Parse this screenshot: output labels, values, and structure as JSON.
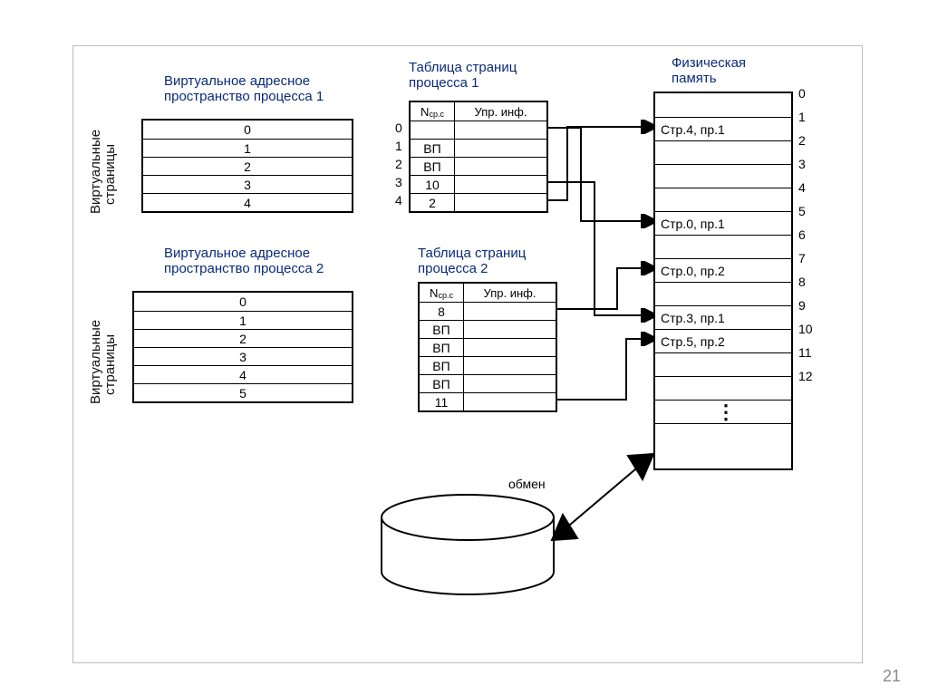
{
  "titles": {
    "vas1_l1": "Виртуальное адресное",
    "vas1_l2": "пространство процесса 1",
    "vas2_l1": "Виртуальное адресное",
    "vas2_l2": "пространство процесса 2",
    "pt1_l1": "Таблица страниц",
    "pt1_l2": "процесса 1",
    "pt2_l1": "Таблица страниц",
    "pt2_l2": "процесса 2",
    "phys_l1": "Физическая",
    "phys_l2": "память",
    "vpages": "Виртуальные",
    "vpages2": "страницы",
    "exchange": "обмен"
  },
  "vas1": [
    "0",
    "1",
    "2",
    "3",
    "4"
  ],
  "vas2": [
    "0",
    "1",
    "2",
    "3",
    "4",
    "5"
  ],
  "pt_hdr": {
    "n": "N",
    "nsub": "ср.с",
    "upr": "Упр. инф."
  },
  "pt1_idx": [
    "0",
    "1",
    "2",
    "3",
    "4"
  ],
  "pt1_rows": [
    {
      "n": "",
      "u": ""
    },
    {
      "n": "ВП",
      "u": ""
    },
    {
      "n": "ВП",
      "u": ""
    },
    {
      "n": "10",
      "u": ""
    },
    {
      "n": "2",
      "u": ""
    }
  ],
  "pt2_rows": [
    {
      "n": "8",
      "u": ""
    },
    {
      "n": "ВП",
      "u": ""
    },
    {
      "n": "ВП",
      "u": ""
    },
    {
      "n": "ВП",
      "u": ""
    },
    {
      "n": "ВП",
      "u": ""
    },
    {
      "n": "11",
      "u": ""
    }
  ],
  "phys_idx": [
    "0",
    "1",
    "2",
    "3",
    "4",
    "5",
    "6",
    "7",
    "8",
    "9",
    "10",
    "11",
    "12"
  ],
  "phys_rows": [
    "",
    "Стр.4, пр.1",
    "",
    "",
    "",
    "Стр.0, пр.1",
    "",
    "Стр.0, пр.2",
    "",
    "Стр.3, пр.1",
    "Стр.5, пр.2",
    "",
    ""
  ],
  "slide": "21"
}
